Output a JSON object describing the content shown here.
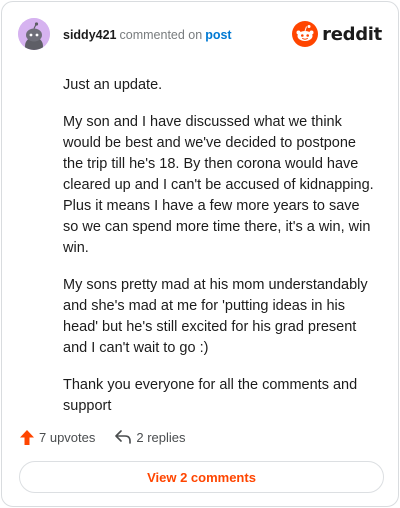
{
  "comment": {
    "username": "siddy421",
    "action_text": "commented on",
    "post_link": "post",
    "paragraphs": [
      "Just an update.",
      "My son and I have discussed what we think would be best and we've decided to postpone the trip till he's 18. By then corona would have cleared up and I can't be accused of kidnapping. Plus it means I have a few more years to save so we can spend more time there, it's a win, win win.",
      "My sons pretty mad at his mom understandably and she's mad at me for 'putting ideas in his head' but he's still excited for his grad present and I can't wait to go :)",
      "Thank you everyone for all the comments and support"
    ],
    "upvotes_label": "7 upvotes",
    "replies_label": "2 replies",
    "view_comments_label": "View 2 comments"
  },
  "brand": {
    "name": "reddit",
    "color": "#ff4500"
  },
  "colors": {
    "upvote": "#ff4500",
    "link": "#0079d3",
    "avatar_bg": "#d6b3f0"
  },
  "icons": {
    "avatar": "snoo-avatar-icon",
    "brand": "reddit-logo-icon",
    "upvote": "upvote-arrow-icon",
    "reply": "reply-arrow-icon"
  }
}
